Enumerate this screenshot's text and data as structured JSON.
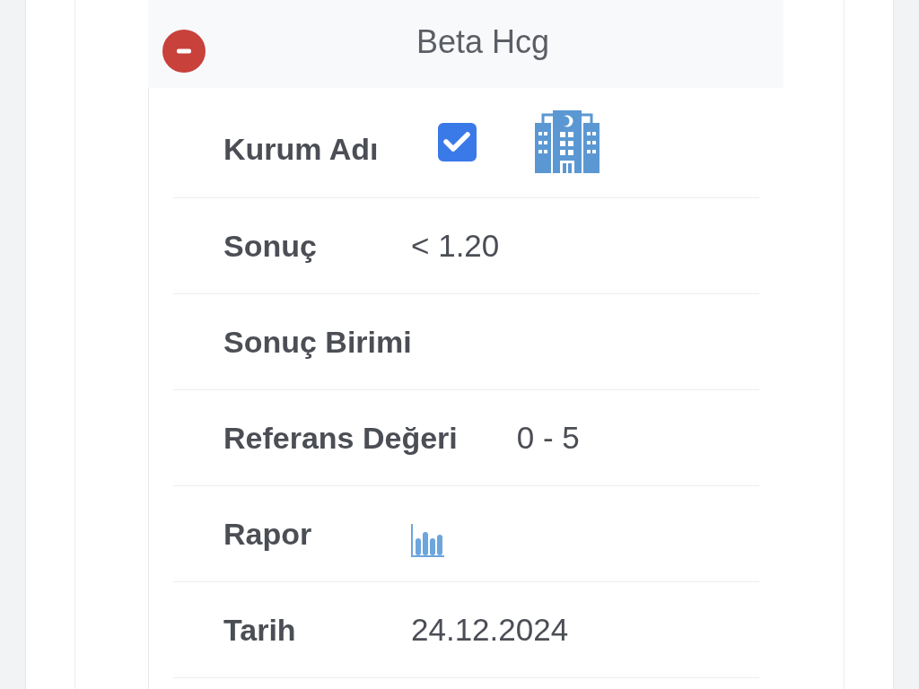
{
  "header": {
    "title": "Beta Hcg",
    "expanded": true
  },
  "rows": [
    {
      "kind": "institution",
      "label": "Kurum Adı",
      "checked": true
    },
    {
      "kind": "text",
      "label": "Sonuç",
      "value": "< 1.20"
    },
    {
      "kind": "text",
      "label": "Sonuç Birimi"
    },
    {
      "kind": "text",
      "label": "Referans Değeri",
      "value": "0 - 5"
    },
    {
      "kind": "report",
      "label": "Rapor"
    },
    {
      "kind": "text",
      "label": "Tarih",
      "value": "24.12.2024"
    }
  ]
}
